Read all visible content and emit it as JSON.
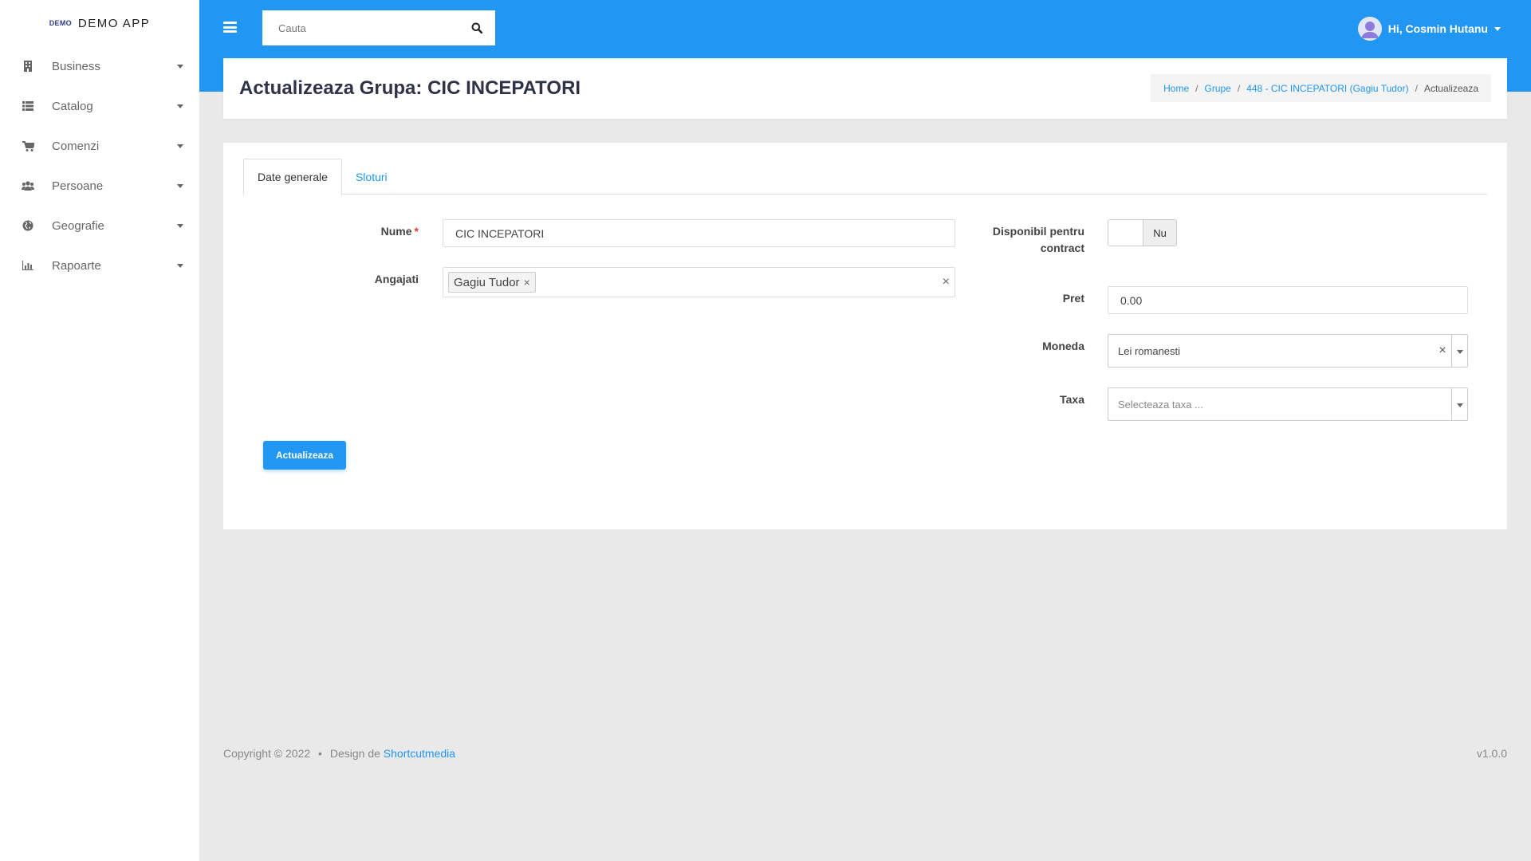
{
  "sidebar": {
    "brand_logo": "DEMO",
    "brand_name": "DEMO APP",
    "items": [
      {
        "label": "Business",
        "icon": "building-icon"
      },
      {
        "label": "Catalog",
        "icon": "list-icon"
      },
      {
        "label": "Comenzi",
        "icon": "cart-icon"
      },
      {
        "label": "Persoane",
        "icon": "users-icon"
      },
      {
        "label": "Geografie",
        "icon": "globe-icon"
      },
      {
        "label": "Rapoarte",
        "icon": "chart-icon"
      }
    ]
  },
  "header": {
    "search_placeholder": "Cauta",
    "user_greeting": "Hi, Cosmin Hutanu",
    "accent_color": "#2196f3"
  },
  "page": {
    "title": "Actualizeaza Grupa: CIC INCEPATORI",
    "breadcrumb": {
      "home": "Home",
      "groups": "Grupe",
      "group": "448 - CIC INCEPATORI (Gagiu Tudor)",
      "current": "Actualizeaza",
      "separator": "/"
    }
  },
  "tabs": [
    {
      "label": "Date generale",
      "active": true
    },
    {
      "label": "Sloturi",
      "active": false
    }
  ],
  "form": {
    "nume_label": "Nume",
    "nume_required": "*",
    "nume_value": "CIC INCEPATORI",
    "angajati_label": "Angajati",
    "angajati_tags": [
      "Gagiu Tudor"
    ],
    "tag_remove": "×",
    "clear": "×",
    "disponibil_label": "Disponibil pentru contract",
    "disponibil_value": "Nu",
    "pret_label": "Pret",
    "pret_value": "0.00",
    "moneda_label": "Moneda",
    "moneda_value": "Lei romanesti",
    "taxa_label": "Taxa",
    "taxa_placeholder": "Selecteaza taxa ...",
    "submit_label": "Actualizeaza"
  },
  "footer": {
    "copyright": "Copyright © 2022",
    "bullet": "•",
    "design_prefix": "Design de",
    "design_link": "Shortcutmedia",
    "version": "v1.0.0"
  }
}
